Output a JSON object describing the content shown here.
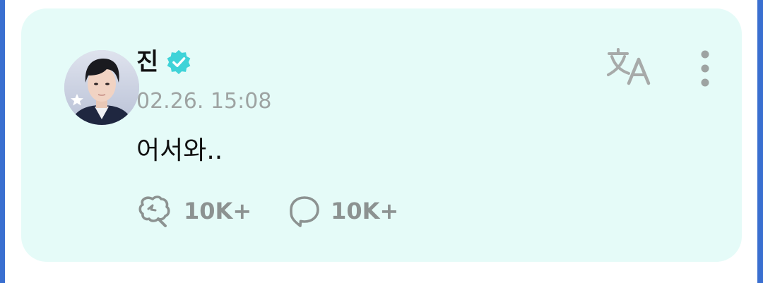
{
  "post": {
    "author": "진",
    "verified": true,
    "timestamp": "02.26. 15:08",
    "body": "어서와.."
  },
  "actions": {
    "translate_icon": "translate-icon",
    "more_icon": "more-vertical-icon"
  },
  "stats": {
    "reactions": "10K+",
    "comments": "10K+"
  },
  "colors": {
    "card_background": "#e5fbf8",
    "verified_badge": "#3fd3d8",
    "muted_text": "#9ea3a2",
    "stat_text": "#8c9291",
    "side_accent": "#3a6fd0"
  }
}
